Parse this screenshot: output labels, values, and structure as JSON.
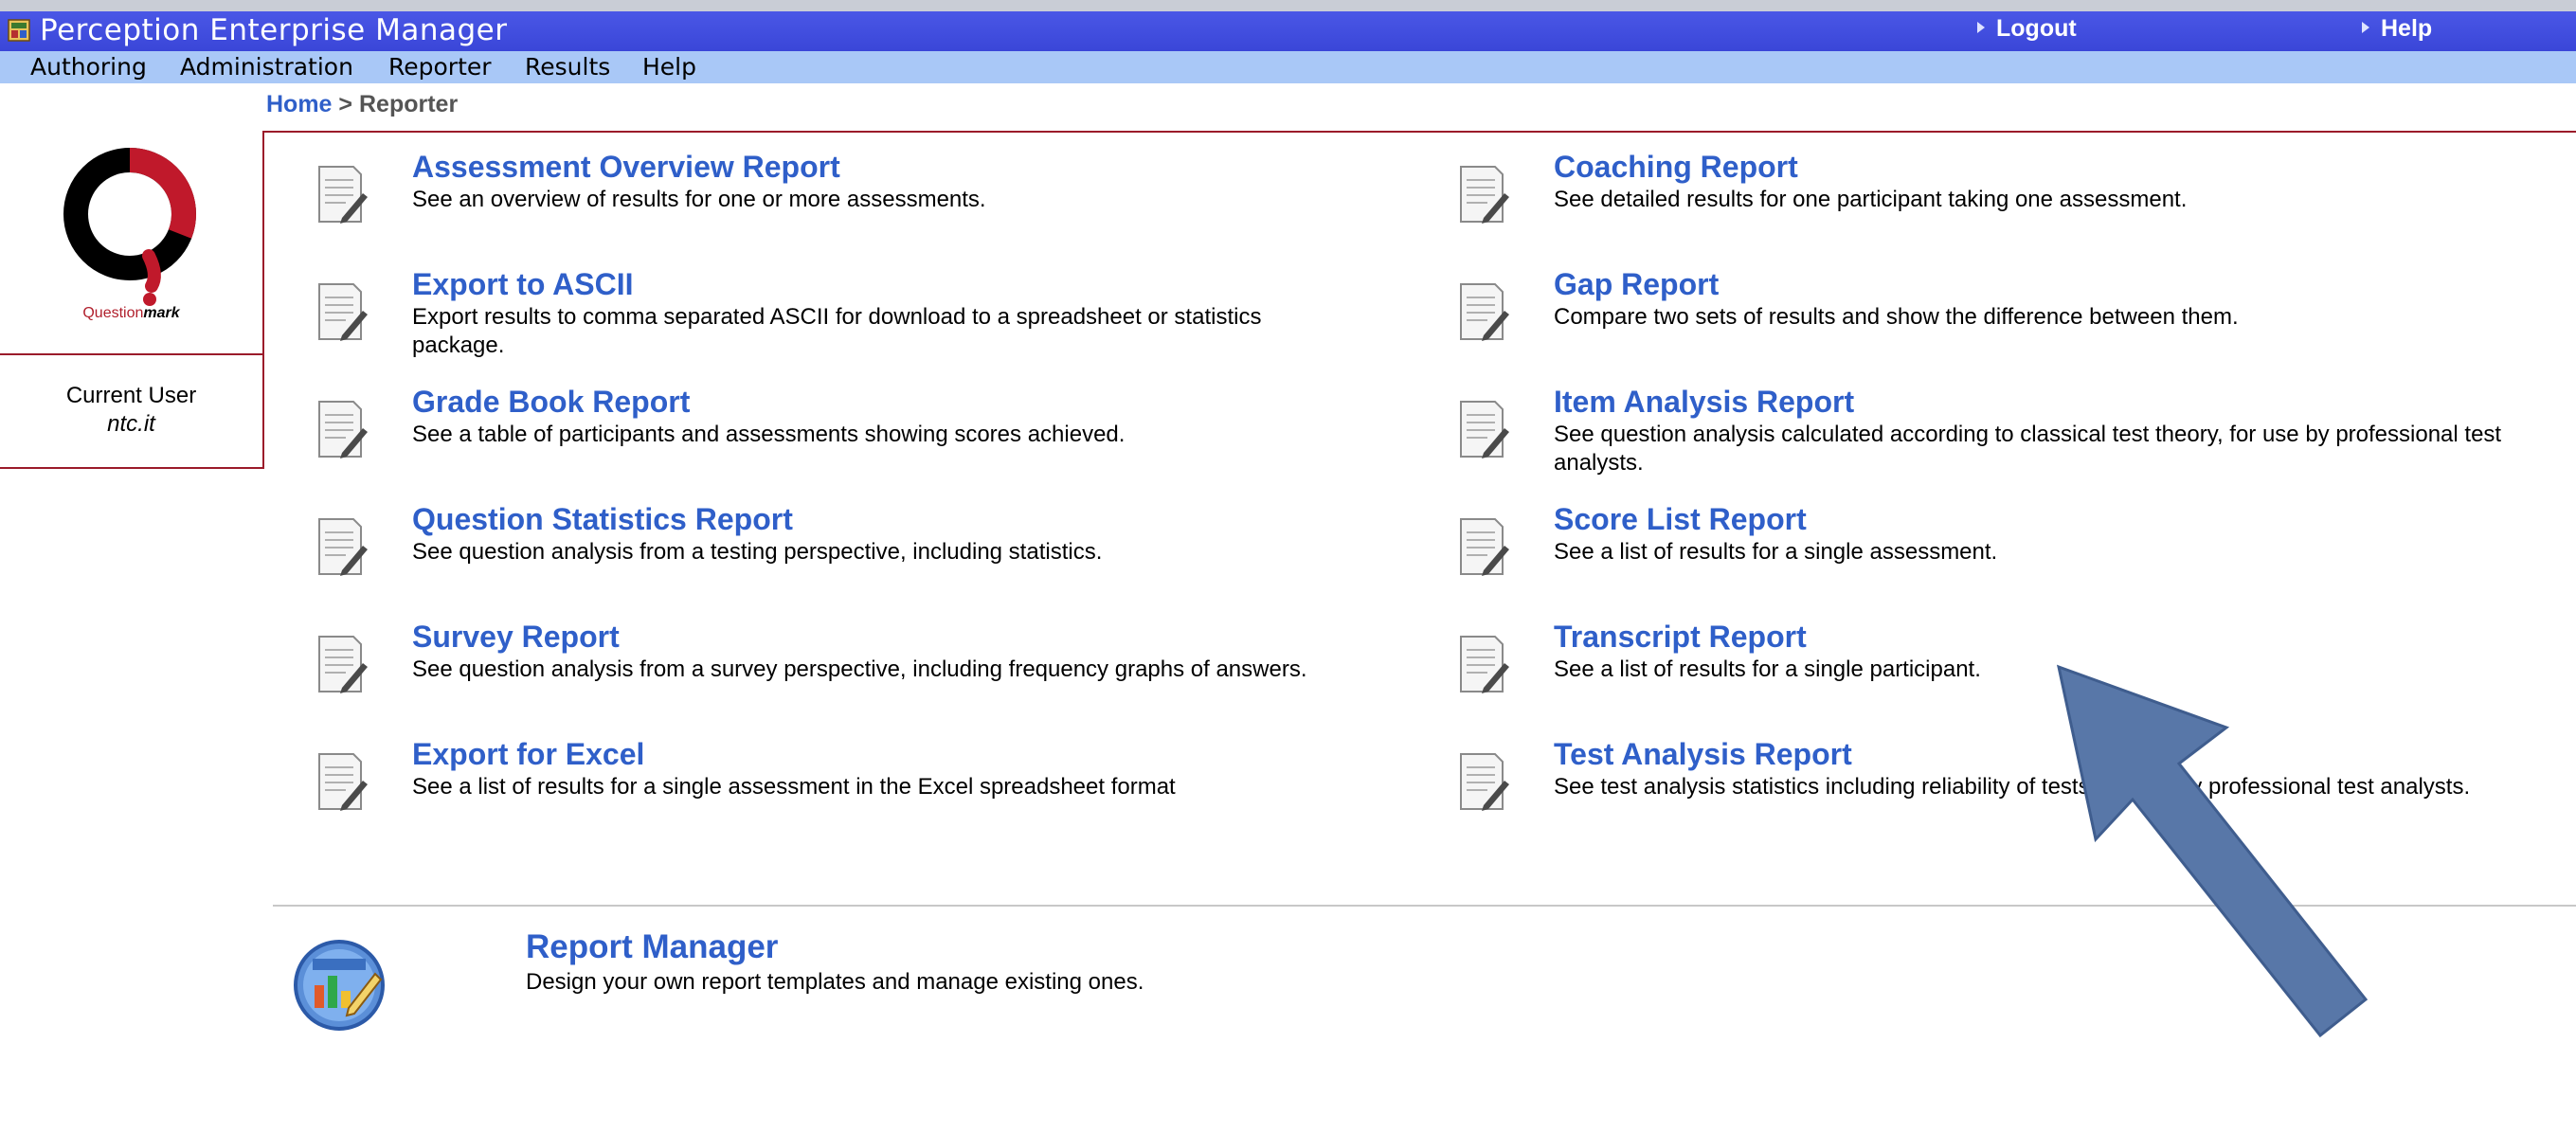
{
  "window": {
    "title": "Perception Enterprise Manager",
    "logout_label": "Logout",
    "help_label": "Help"
  },
  "menu": {
    "items": [
      "Authoring",
      "Administration",
      "Reporter",
      "Results",
      "Help"
    ]
  },
  "breadcrumb": {
    "home": "Home",
    "separator": ">",
    "current": "Reporter"
  },
  "sidebar": {
    "logo_text_brand": "Question",
    "logo_text_mark": "mark",
    "current_user_label": "Current User",
    "current_user_name": "ntc.it"
  },
  "reports": {
    "left": [
      {
        "title": "Assessment Overview Report",
        "desc": "See an overview of results for one or more assessments."
      },
      {
        "title": "Export to ASCII",
        "desc": "Export results to comma separated ASCII for download to a spreadsheet or statistics package."
      },
      {
        "title": "Grade Book Report",
        "desc": "See a table of participants and assessments showing scores achieved."
      },
      {
        "title": "Question Statistics Report",
        "desc": "See question analysis from a testing perspective, including statistics."
      },
      {
        "title": "Survey Report",
        "desc": "See question analysis from a survey perspective, including frequency graphs of answers."
      },
      {
        "title": "Export for Excel",
        "desc": "See a list of results for a single assessment in the Excel spreadsheet format"
      }
    ],
    "right": [
      {
        "title": "Coaching Report",
        "desc": "See detailed results for one participant taking one assessment."
      },
      {
        "title": "Gap Report",
        "desc": "Compare two sets of results and show the difference between them."
      },
      {
        "title": "Item Analysis Report",
        "desc": "See question analysis calculated according to classical test theory, for use by professional test analysts."
      },
      {
        "title": "Score List Report",
        "desc": "See a list of results for a single assessment."
      },
      {
        "title": "Transcript Report",
        "desc": "See a list of results for a single participant."
      },
      {
        "title": "Test Analysis Report",
        "desc": "See test analysis statistics including reliability of tests, for use by professional test analysts."
      }
    ]
  },
  "report_manager": {
    "title": "Report Manager",
    "desc": "Design your own report templates and manage existing ones."
  },
  "colors": {
    "title_bar": "#3f4be0",
    "menu_bar": "#a9c8f7",
    "link": "#2f5fc9",
    "accent_border": "#9b1b2a",
    "annotation_arrow": "#5877a8"
  },
  "icons": {
    "report": "document-pencil-icon",
    "report_manager": "chart-edit-icon",
    "app": "app-window-icon",
    "annotation": "arrow-annotation"
  }
}
